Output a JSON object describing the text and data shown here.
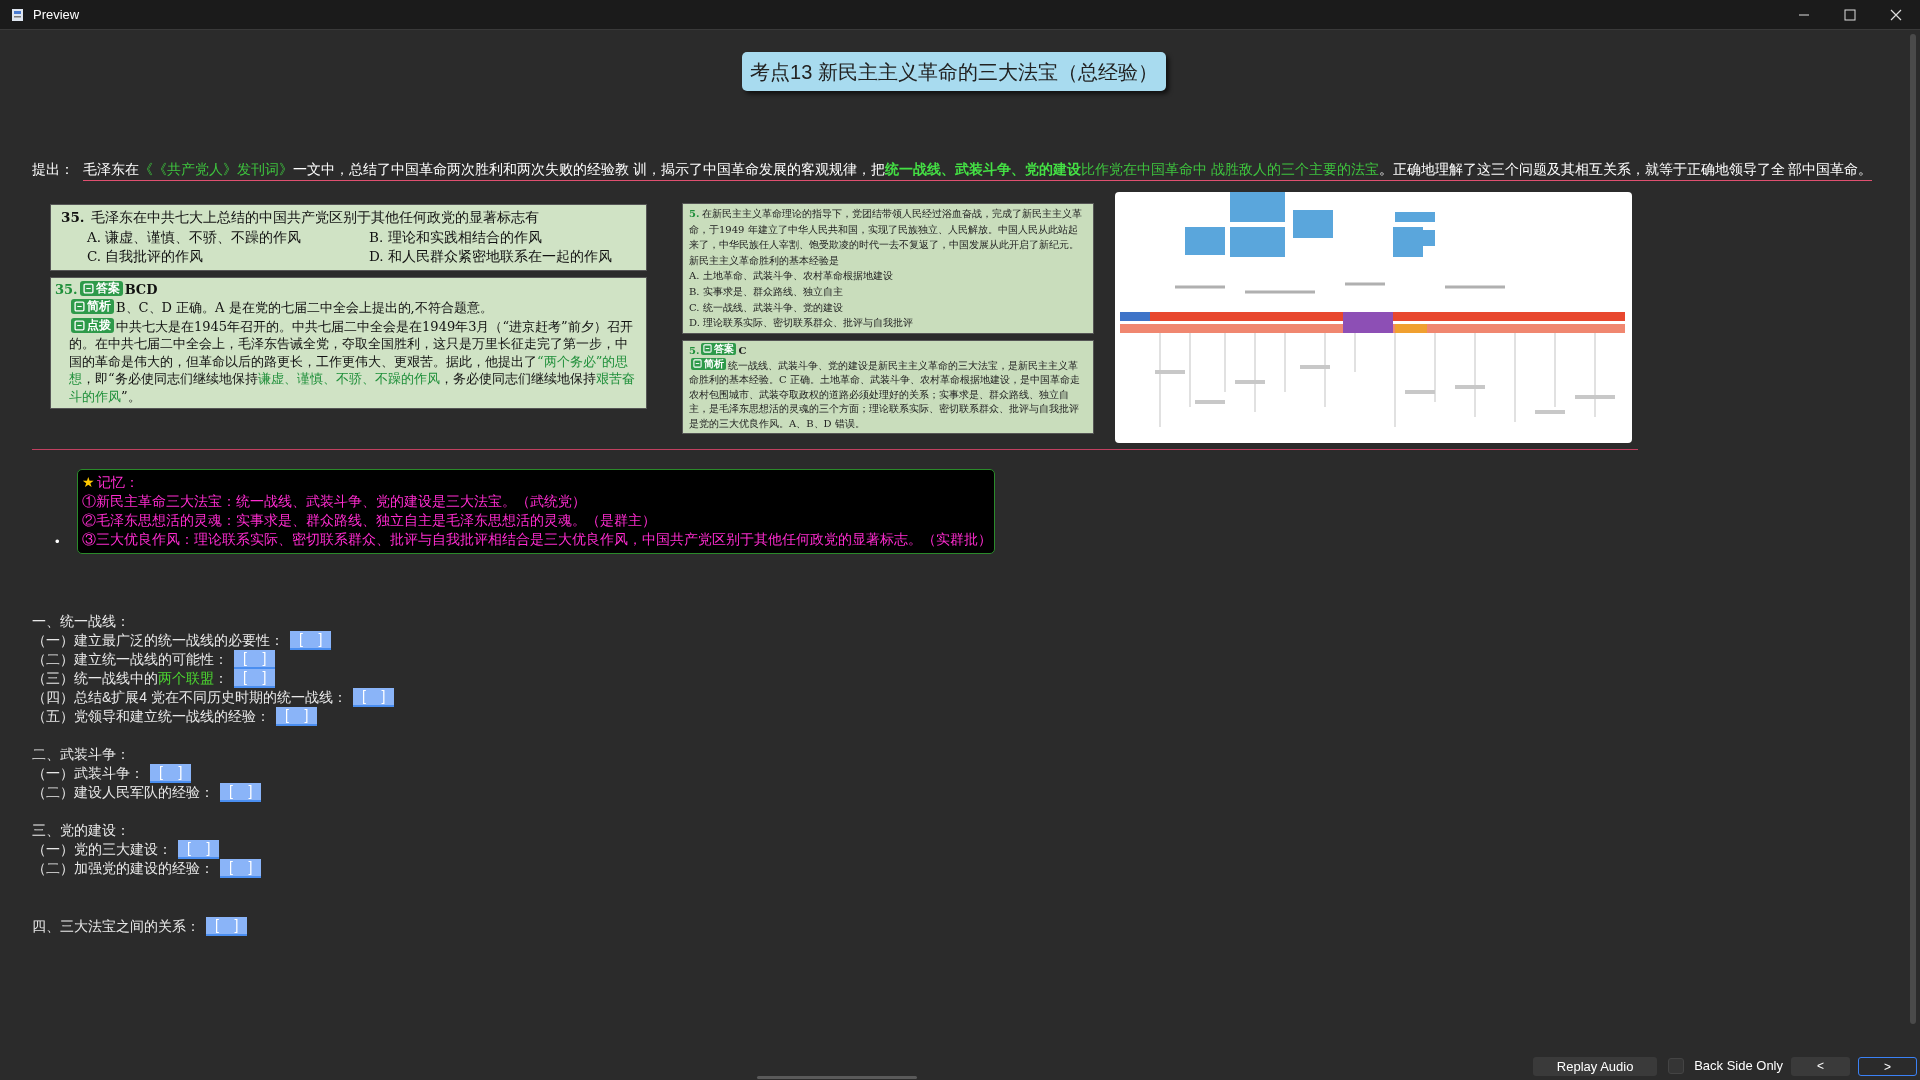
{
  "window": {
    "title": "Preview"
  },
  "heading": "考点13 新民主主义革命的三大法宝（总经验）",
  "intro": {
    "label": "提出：",
    "segments": [
      {
        "text": "毛泽东在",
        "kind": "plain"
      },
      {
        "text": "《《共产党人》发刊词》",
        "kind": "green"
      },
      {
        "text": "一文中，总结了中国革命两次胜利和两次失败的经验教 训，揭示了中国革命发展的客观规律，把",
        "kind": "plain"
      },
      {
        "text": "统一战线、武装斗争、党的建设",
        "kind": "key"
      },
      {
        "text": "比作党在中国革命中 战胜敌人的三个主要的法宝",
        "kind": "green"
      },
      {
        "text": "。正确地理解了这三个问题及其相互关系，就等于正确地领导了全 部中国革命。",
        "kind": "plain"
      }
    ]
  },
  "question_35": {
    "number": "35.",
    "stem": "毛泽东在中共七大上总结的中国共产党区别于其他任何政党的显著标志有",
    "options": [
      "A. 谦虚、谨慎、不骄、不躁的作风",
      "B. 理论和实践相结合的作风",
      "C. 自我批评的作风",
      "D. 和人民群众紧密地联系在一起的作风"
    ]
  },
  "answer_35": {
    "number": "35.",
    "answer_badge": "答案",
    "answer": "BCD",
    "analysis_badge": "简析",
    "analysis": "B、C、D 正确。A 是在党的七届二中全会上提出的,不符合题意。",
    "tip_badge": "点拨",
    "tip": [
      {
        "text": "中共七大是在1945年召开的。中共七届二中全会是在1949年3月（“进京赶考”前夕）召开的。在中共七届二中全会上，毛泽东告诫全党，夺取全国胜利，这只是万里长征走完了第一步，中国的革命是伟大的，但革命以后的路更长，工作更伟大、更艰苦。据此，他提出了",
        "kind": "plain"
      },
      {
        "text": "“两个务必”的思想",
        "kind": "green"
      },
      {
        "text": "，即“务必使同志们继续地保持",
        "kind": "plain"
      },
      {
        "text": "谦虚、谨慎、不骄、不躁的作风",
        "kind": "green"
      },
      {
        "text": "，务必使同志们继续地保持",
        "kind": "plain"
      },
      {
        "text": "艰苦奋斗的作风",
        "kind": "green"
      },
      {
        "text": "”。",
        "kind": "plain"
      }
    ]
  },
  "question_5": {
    "number": "5.",
    "stem": "在新民主主义革命理论的指导下，党团结带领人民经过浴血奋战，完成了新民主主义革命，于1949 年建立了中华人民共和国，实现了民族独立、人民解放。中国人民从此站起来了，中华民族任人宰割、饱受欺凌的时代一去不复返了，中国发展从此开启了新纪元。新民主主义革命胜利的基本经验是",
    "options": [
      "A. 土地革命、武装斗争、农村革命根据地建设",
      "B. 实事求是、群众路线、独立自主",
      "C. 统一战线、武装斗争、党的建设",
      "D. 理论联系实际、密切联系群众、批评与自我批评"
    ]
  },
  "answer_5": {
    "number": "5.",
    "answer_badge": "答案",
    "answer": "C",
    "analysis_badge": "简析",
    "analysis": "统一战线、武装斗争、党的建设是新民主主义革命的三大法宝，是新民主主义革命胜利的基本经验。C 正确。土地革命、武装斗争、农村革命根据地建设，是中国革命走农村包围城市、武装夺取政权的道路必须处理好的关系；实事求是、群众路线、独立自主，是毛泽东思想活的灵魂的三个方面；理论联系实际、密切联系群众、批评与自我批评是党的三大优良作风。A、B、D 错误。"
  },
  "memory": {
    "bullet": "•",
    "star": "★",
    "title": "记忆：",
    "lines": [
      "①新民主革命三大法宝：统一战线、武装斗争、党的建设是三大法宝。（武统党）",
      "②毛泽东思想活的灵魂：实事求是、群众路线、独立自主是毛泽东思想活的灵魂。（是群主）",
      "③三大优良作风：理论联系实际、密切联系群众、批评与自我批评相结合是三大优良作风，中国共产党区别于其他任何政党的显著标志。（实群批）"
    ]
  },
  "outline": [
    {
      "title": "一、统一战线：",
      "items": [
        {
          "segments": [
            {
              "text": "（一）建立最广泛的统一战线的必要性：",
              "kind": "plain"
            }
          ],
          "blank": "[    ]"
        },
        {
          "segments": [
            {
              "text": "（二）建立统一战线的可能性：",
              "kind": "plain"
            }
          ],
          "blank": "[    ]"
        },
        {
          "segments": [
            {
              "text": "（三）统一战线中的",
              "kind": "plain"
            },
            {
              "text": "两个联盟",
              "kind": "green"
            },
            {
              "text": "：",
              "kind": "plain"
            }
          ],
          "blank": "[    ]"
        },
        {
          "segments": [
            {
              "text": "（四）总结&扩展4 党在不同历史时期的统一战线：",
              "kind": "plain"
            }
          ],
          "blank": "[    ]"
        },
        {
          "segments": [
            {
              "text": "（五）党领导和建立统一战线的经验：",
              "kind": "plain"
            }
          ],
          "blank": "[    ]"
        }
      ]
    },
    {
      "title": "二、武装斗争：",
      "items": [
        {
          "segments": [
            {
              "text": "（一）武装斗争：",
              "kind": "plain"
            }
          ],
          "blank": "[    ]"
        },
        {
          "segments": [
            {
              "text": "（二）建设人民军队的经验：",
              "kind": "plain"
            }
          ],
          "blank": "[    ]"
        }
      ]
    },
    {
      "title": "三、党的建设：",
      "items": [
        {
          "segments": [
            {
              "text": "（一）党的三大建设：",
              "kind": "plain"
            }
          ],
          "blank": "[    ]"
        },
        {
          "segments": [
            {
              "text": "（二）加强党的建设的经验：",
              "kind": "plain"
            }
          ],
          "blank": "[    ]"
        }
      ]
    },
    {
      "title": "四、三大法宝之间的关系：",
      "blank": "[    ]"
    }
  ],
  "footer": {
    "replay": "Replay Audio",
    "back_side_only": {
      "label": "Back Side Only",
      "checked": false
    },
    "prev": "<",
    "next": ">"
  }
}
